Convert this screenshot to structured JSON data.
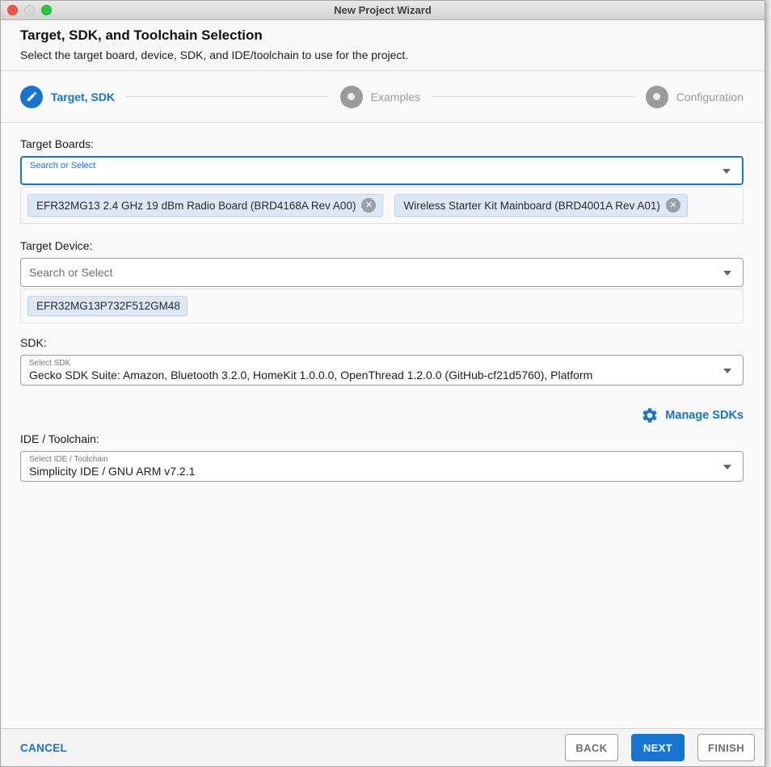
{
  "window": {
    "title": "New Project Wizard"
  },
  "header": {
    "title": "Target, SDK, and Toolchain Selection",
    "subtitle": "Select the target board, device, SDK, and IDE/toolchain to use for the project."
  },
  "stepper": {
    "steps": [
      {
        "label": "Target, SDK",
        "state": "active",
        "icon": "pencil-icon"
      },
      {
        "label": "Examples",
        "state": "inactive",
        "icon": "dot-icon"
      },
      {
        "label": "Configuration",
        "state": "inactive",
        "icon": "dot-icon"
      }
    ]
  },
  "form": {
    "target_boards": {
      "label": "Target Boards:",
      "placeholder": "Search or Select",
      "chips": [
        {
          "label": "EFR32MG13 2.4 GHz 19 dBm Radio Board (BRD4168A Rev A00)",
          "remove_icon": "✕"
        },
        {
          "label": "Wireless Starter Kit Mainboard (BRD4001A Rev A01)",
          "remove_icon": "✕"
        }
      ]
    },
    "target_device": {
      "label": "Target Device:",
      "placeholder": "Search or Select",
      "chips": [
        {
          "label": "EFR32MG13P732F512GM48"
        }
      ]
    },
    "sdk": {
      "label": "SDK:",
      "select_label": "Select SDK",
      "value": "Gecko SDK Suite: Amazon, Bluetooth 3.2.0, HomeKit 1.0.0.0, OpenThread 1.2.0.0 (GitHub-cf21d5760), Platform",
      "manage_label": "Manage SDKs",
      "manage_icon": "gear-icon"
    },
    "ide_toolchain": {
      "label": "IDE / Toolchain:",
      "select_label": "Select IDE / Toolchain",
      "value": "Simplicity IDE / GNU ARM v7.2.1"
    }
  },
  "footer": {
    "cancel_label": "CANCEL",
    "back_label": "BACK",
    "next_label": "NEXT",
    "finish_label": "FINISH"
  },
  "colors": {
    "accent_blue": "#1774d1",
    "focus_border_blue": "#1a73e8",
    "chip_background": "#dce8f5",
    "inactive_step_gray": "#9b9b9b",
    "traffic_red": "#f1564d",
    "traffic_green": "#2dc83f"
  }
}
